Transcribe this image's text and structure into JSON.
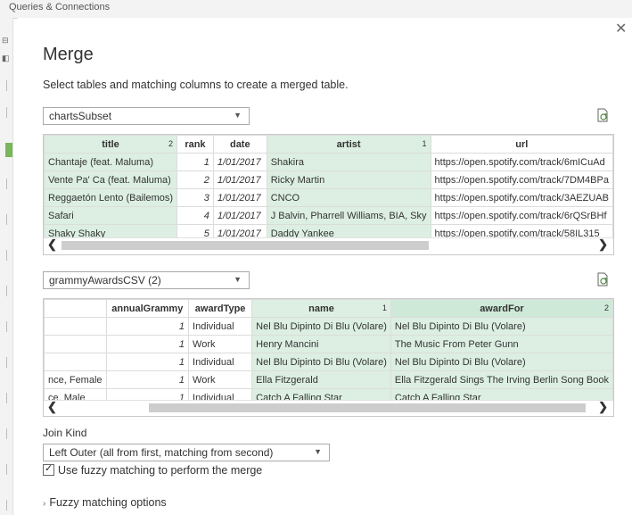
{
  "background": {
    "ribbon_text": "Queries & Connections"
  },
  "dialog": {
    "title": "Merge",
    "subtitle": "Select tables and matching columns to create a merged table.",
    "close_glyph": "✕"
  },
  "table1": {
    "selected": "chartsSubset",
    "columns": [
      {
        "label": "title",
        "match_index": "2",
        "selected": true
      },
      {
        "label": "rank",
        "match_index": "",
        "selected": false
      },
      {
        "label": "date",
        "match_index": "",
        "selected": false
      },
      {
        "label": "artist",
        "match_index": "1",
        "selected": true
      },
      {
        "label": "url",
        "match_index": "",
        "selected": false
      }
    ],
    "rows": [
      [
        "Chantaje (feat. Maluma)",
        "1",
        "1/01/2017",
        "Shakira",
        "https://open.spotify.com/track/6mICuAd"
      ],
      [
        "Vente Pa' Ca (feat. Maluma)",
        "2",
        "1/01/2017",
        "Ricky Martin",
        "https://open.spotify.com/track/7DM4BPa"
      ],
      [
        "Reggaetón Lento (Bailemos)",
        "3",
        "1/01/2017",
        "CNCO",
        "https://open.spotify.com/track/3AEZUAB"
      ],
      [
        "Safari",
        "4",
        "1/01/2017",
        "J Balvin, Pharrell Williams, BIA, Sky",
        "https://open.spotify.com/track/6rQSrBHf"
      ],
      [
        "Shaky Shaky",
        "5",
        "1/01/2017",
        "Daddy Yankee",
        "https://open.spotify.com/track/58IL315"
      ]
    ]
  },
  "table2": {
    "selected": "grammyAwardsCSV (2)",
    "columns": [
      {
        "label": "",
        "match_index": "",
        "selected": false
      },
      {
        "label": "annualGrammy",
        "match_index": "",
        "selected": false
      },
      {
        "label": "awardType",
        "match_index": "",
        "selected": false
      },
      {
        "label": "name",
        "match_index": "1",
        "selected": true
      },
      {
        "label": "awardFor",
        "match_index": "2",
        "selected": true
      }
    ],
    "rows": [
      [
        "",
        "1",
        "Individual",
        "Nel Blu Dipinto Di Blu (Volare)",
        "Nel Blu Dipinto Di Blu (Volare)"
      ],
      [
        "",
        "1",
        "Work",
        "Henry Mancini",
        "The Music From Peter Gunn"
      ],
      [
        "",
        "1",
        "Individual",
        "Nel Blu Dipinto Di Blu (Volare)",
        "Nel Blu Dipinto Di Blu (Volare)"
      ],
      [
        "nce, Female",
        "1",
        "Work",
        "Ella Fitzgerald",
        "Ella Fitzgerald Sings The Irving Berlin Song Book"
      ],
      [
        "ce, Male",
        "1",
        "Individual",
        "Catch A Falling Star",
        "Catch A Falling Star"
      ]
    ]
  },
  "join": {
    "label": "Join Kind",
    "selected": "Left Outer (all from first, matching from second)"
  },
  "fuzzy_checkbox": {
    "label": "Use fuzzy matching to perform the merge",
    "checked": true
  },
  "fuzzy_options": {
    "label": "Fuzzy matching options"
  }
}
